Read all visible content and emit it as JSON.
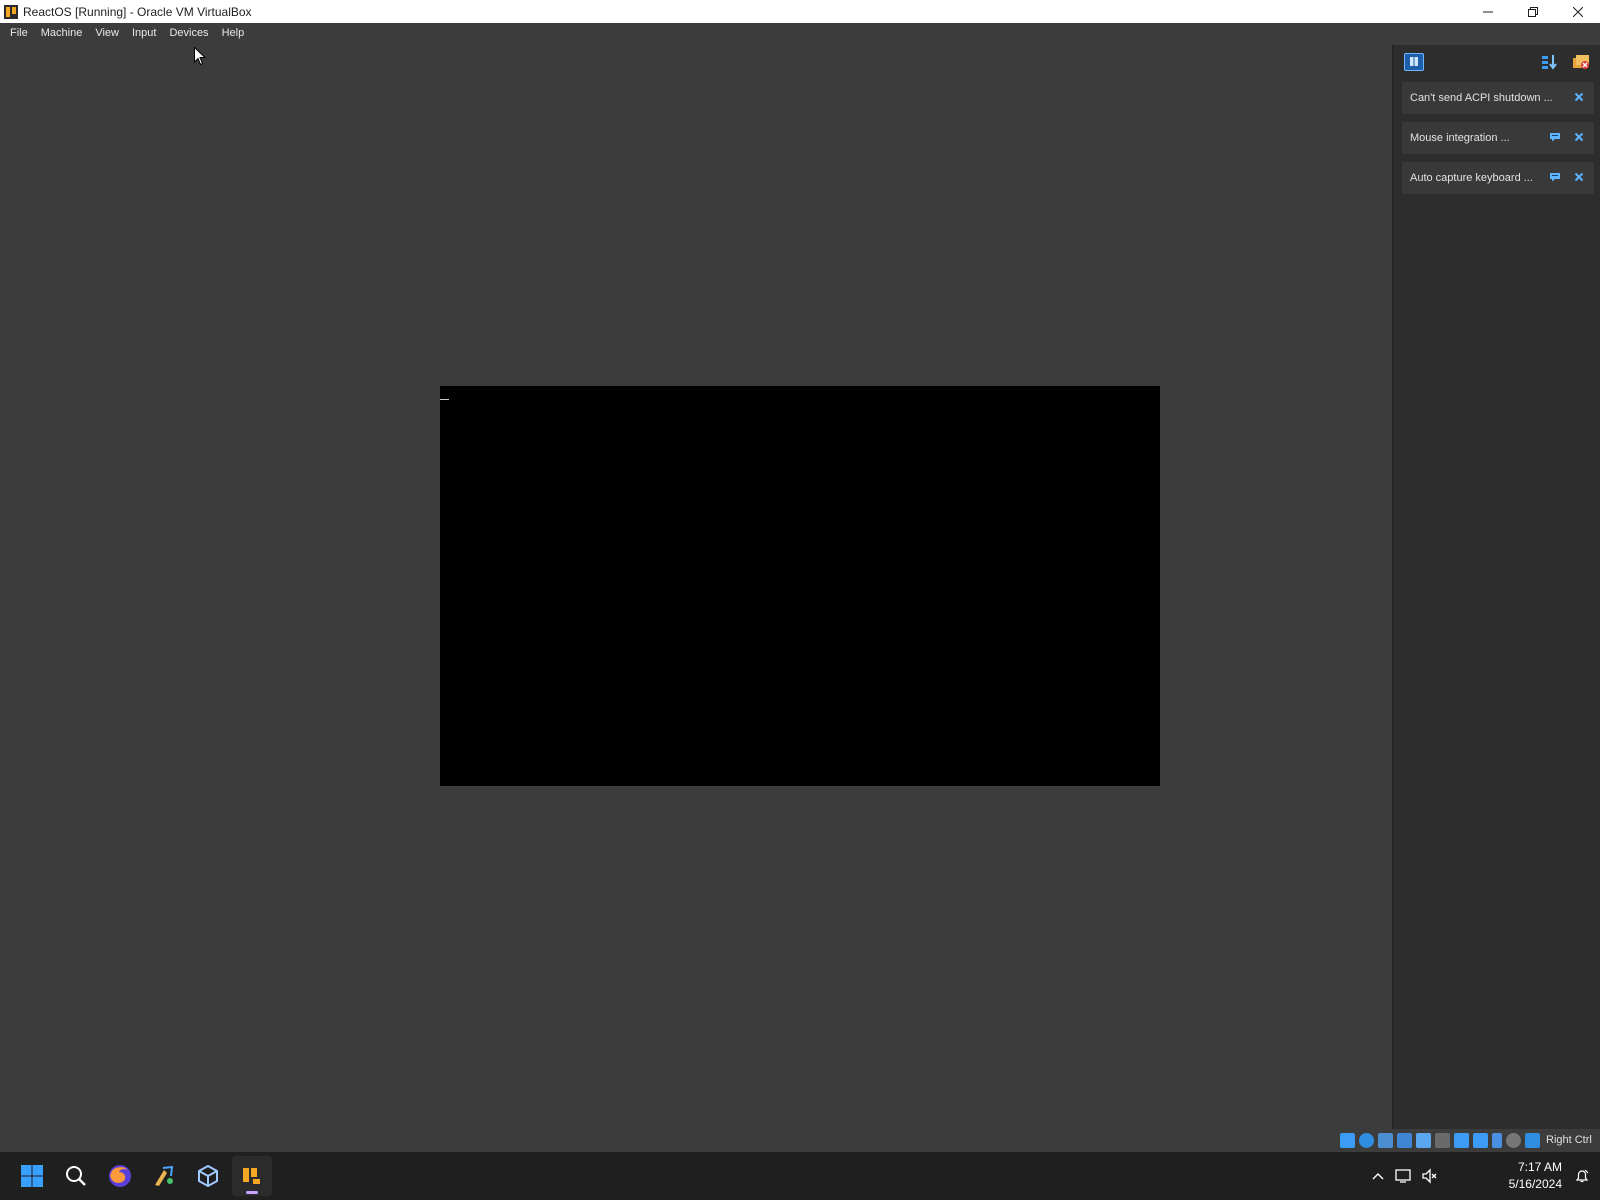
{
  "window": {
    "title": "ReactOS [Running] - Oracle VM VirtualBox",
    "controls": [
      "minimize",
      "restore",
      "close"
    ]
  },
  "menu": {
    "items": [
      "File",
      "Machine",
      "View",
      "Input",
      "Devices",
      "Help"
    ]
  },
  "notifications": {
    "toolbar_icons": [
      "notification-center-icon",
      "sort-order-icon",
      "clear-all-icon"
    ],
    "items": [
      {
        "text": "Can't send ACPI shutdown ...",
        "has_help": false
      },
      {
        "text": "Mouse integration ...",
        "has_help": true
      },
      {
        "text": "Auto capture keyboard ...",
        "has_help": true
      }
    ]
  },
  "statusbar": {
    "icons": [
      "hard-disk-icon",
      "optical-drive-icon",
      "audio-icon",
      "network-icon",
      "usb-icon",
      "shared-folders-icon",
      "display-icon",
      "video-capture-icon",
      "cpu-icon",
      "mouse-integration-icon",
      "keyboard-icon"
    ],
    "host_key": "Right Ctrl"
  },
  "taskbar": {
    "apps": [
      "windows-start-icon",
      "search-icon",
      "firefox-icon",
      "app-icon",
      "virtualbox-manager-icon",
      "virtualbox-vm-icon"
    ],
    "time": "7:17 AM",
    "date": "5/16/2024"
  },
  "colors": {
    "vm_background": "#3c3c3c",
    "guest_screen": "#000000",
    "panel": "#2d2d2d",
    "taskbar": "#1f1f1f",
    "accent_blue": "#3b9bf5"
  }
}
